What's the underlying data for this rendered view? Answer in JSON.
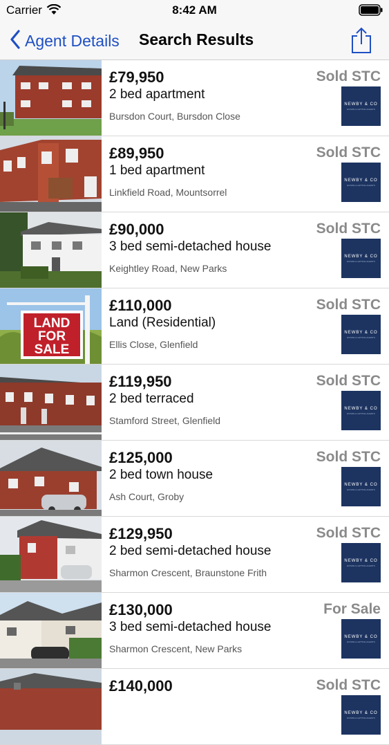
{
  "status_bar": {
    "carrier": "Carrier",
    "time": "8:42 AM"
  },
  "nav": {
    "back_label": "Agent Details",
    "title": "Search Results"
  },
  "agent_logo": {
    "name": "NEWBY & CO",
    "tagline": "ESTATE & LETTING AGENTS"
  },
  "colors": {
    "accent": "#1f4fc4",
    "logo_bg": "#1d3461",
    "status_text": "#8a8a8a"
  },
  "listings": [
    {
      "price": "£79,950",
      "type": "2 bed apartment",
      "address": "Bursdon Court, Bursdon Close",
      "status": "Sold STC",
      "image": "red-brick-block-icon"
    },
    {
      "price": "£89,950",
      "type": "1 bed apartment",
      "address": "Linkfield Road, Mountsorrel",
      "status": "Sold STC",
      "image": "brick-terrace-icon"
    },
    {
      "price": "£90,000",
      "type": "3 bed semi-detached house",
      "address": "Keightley Road, New Parks",
      "status": "Sold STC",
      "image": "white-render-house-icon"
    },
    {
      "price": "£110,000",
      "type": "Land (Residential)",
      "address": "Ellis Close, Glenfield",
      "status": "Sold STC",
      "image": "land-for-sale-sign-icon"
    },
    {
      "price": "£119,950",
      "type": "2 bed terraced",
      "address": "Stamford Street, Glenfield",
      "status": "Sold STC",
      "image": "brick-terrace-street-icon"
    },
    {
      "price": "£125,000",
      "type": "2 bed town house",
      "address": "Ash Court, Groby",
      "status": "Sold STC",
      "image": "brick-town-house-icon"
    },
    {
      "price": "£129,950",
      "type": "2 bed semi-detached house",
      "address": "Sharmon Crescent, Braunstone Frith",
      "status": "Sold STC",
      "image": "red-semi-house-icon"
    },
    {
      "price": "£130,000",
      "type": "3 bed semi-detached house",
      "address": "Sharmon Crescent, New Parks",
      "status": "For Sale",
      "image": "semi-house-car-icon"
    },
    {
      "price": "£140,000",
      "type": "",
      "address": "",
      "status": "Sold STC",
      "image": "brick-house-icon"
    }
  ]
}
